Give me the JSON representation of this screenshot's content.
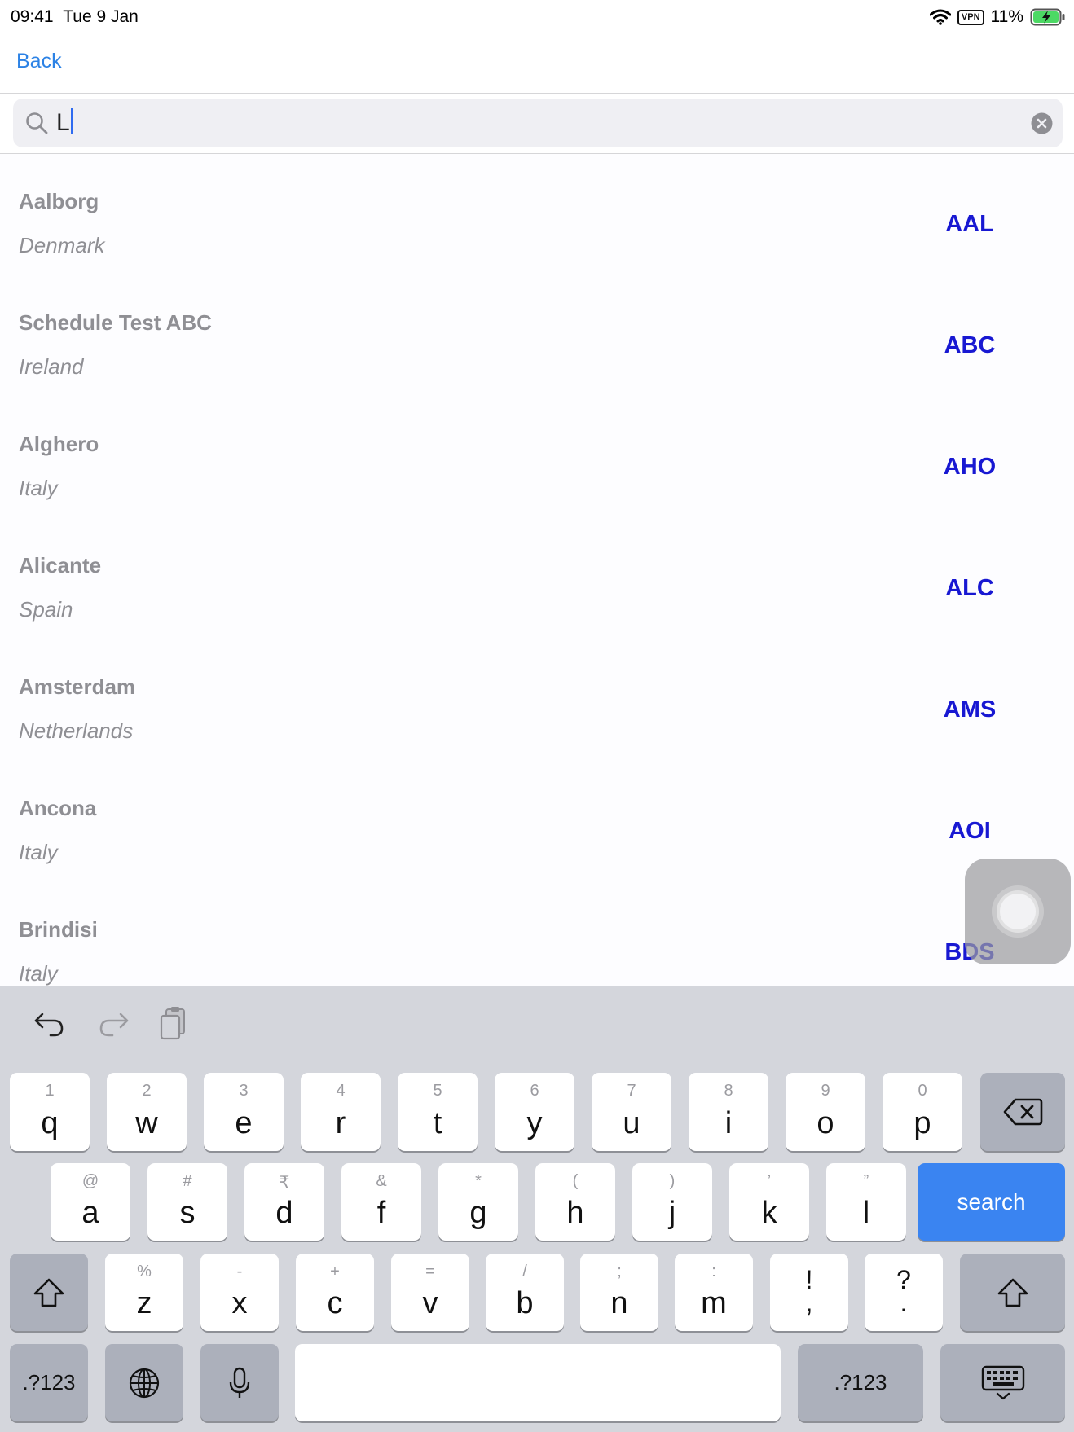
{
  "status_bar": {
    "time": "09:41",
    "date": "Tue 9 Jan",
    "vpn": "VPN",
    "battery": "11%"
  },
  "nav": {
    "back": "Back"
  },
  "search": {
    "value": "L"
  },
  "airports": [
    {
      "name": "Aalborg",
      "country": "Denmark",
      "code": "AAL"
    },
    {
      "name": "Schedule Test ABC",
      "country": "Ireland",
      "code": "ABC"
    },
    {
      "name": "Alghero",
      "country": "Italy",
      "code": "AHO"
    },
    {
      "name": "Alicante",
      "country": "Spain",
      "code": "ALC"
    },
    {
      "name": "Amsterdam",
      "country": "Netherlands",
      "code": "AMS"
    },
    {
      "name": "Ancona",
      "country": "Italy",
      "code": "AOI"
    },
    {
      "name": "Brindisi",
      "country": "Italy",
      "code": "BDS"
    }
  ],
  "keyboard": {
    "row1": [
      {
        "hint": "1",
        "key": "q"
      },
      {
        "hint": "2",
        "key": "w"
      },
      {
        "hint": "3",
        "key": "e"
      },
      {
        "hint": "4",
        "key": "r"
      },
      {
        "hint": "5",
        "key": "t"
      },
      {
        "hint": "6",
        "key": "y"
      },
      {
        "hint": "7",
        "key": "u"
      },
      {
        "hint": "8",
        "key": "i"
      },
      {
        "hint": "9",
        "key": "o"
      },
      {
        "hint": "0",
        "key": "p"
      }
    ],
    "row2": [
      {
        "hint": "@",
        "key": "a"
      },
      {
        "hint": "#",
        "key": "s"
      },
      {
        "hint": "₹",
        "key": "d"
      },
      {
        "hint": "&",
        "key": "f"
      },
      {
        "hint": "*",
        "key": "g"
      },
      {
        "hint": "(",
        "key": "h"
      },
      {
        "hint": ")",
        "key": "j"
      },
      {
        "hint": "’",
        "key": "k"
      },
      {
        "hint": "”",
        "key": "l"
      }
    ],
    "row3": [
      {
        "hint": "%",
        "key": "z"
      },
      {
        "hint": "-",
        "key": "x"
      },
      {
        "hint": "+",
        "key": "c"
      },
      {
        "hint": "=",
        "key": "v"
      },
      {
        "hint": "/",
        "key": "b"
      },
      {
        "hint": ";",
        "key": "n"
      },
      {
        "hint": ":",
        "key": "m"
      }
    ],
    "punct": [
      {
        "top": "!",
        "bottom": ","
      },
      {
        "top": "?",
        "bottom": "."
      }
    ],
    "search_label": "search",
    "numbers_label": ".?123",
    "icons": [
      "undo-icon",
      "redo-icon",
      "paste-icon",
      "delete-icon",
      "shift-icon",
      "globe-icon",
      "microphone-icon",
      "keyboard-dismiss-icon"
    ],
    "accent_color": "#3a84f1"
  },
  "colors": {
    "link": "#2c82e5",
    "code": "#1818d2",
    "muted_text": "#8f8f94"
  }
}
